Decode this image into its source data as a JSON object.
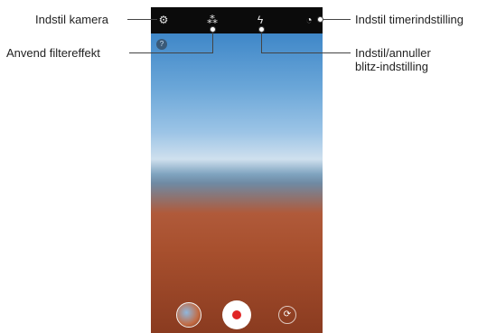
{
  "callouts": {
    "camera_settings": "Indstil kamera",
    "filter_effect": "Anvend filtereffekt",
    "flash_line1": "Indstil/annuller",
    "flash_line2": "blitz-indstilling",
    "timer": "Indstil timerindstilling"
  },
  "icons": {
    "settings": "gear-icon",
    "filter": "filter-icon",
    "flash": "flash-icon",
    "timer": "timer-icon",
    "help": "help-icon",
    "switch_camera": "switch-camera-icon"
  },
  "glyphs": {
    "settings": "⚙",
    "filter": "⁂",
    "flash": "ϟ",
    "timer": "◔",
    "help": "?",
    "switch_camera": "⟳"
  },
  "colors": {
    "shutter_dot": "#e02525"
  }
}
